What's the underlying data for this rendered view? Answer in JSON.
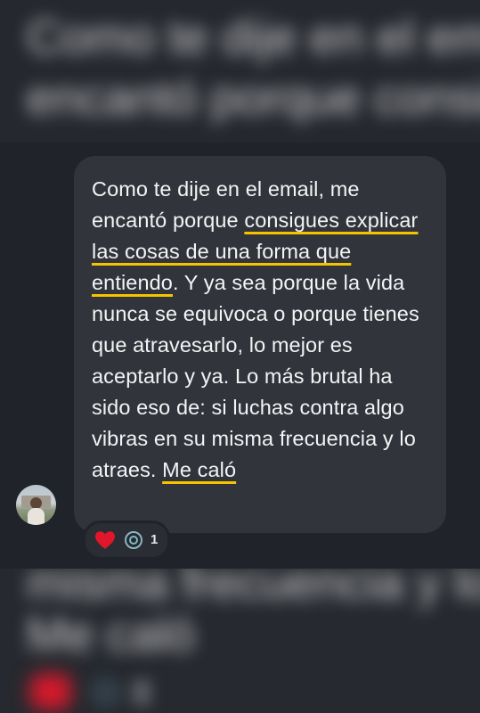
{
  "message": {
    "segments": [
      {
        "text": "Como te dije en el email, me encantó porque ",
        "underline": false
      },
      {
        "text": "consigues explicar las cosas de una forma que entiendo",
        "underline": true
      },
      {
        "text": ". Y ya sea porque la vida nunca se equivoca o porque tienes que atravesarlo, lo mejor es aceptarlo y ya. Lo más brutal ha sido eso de: si luchas contra algo vibras en su misma frecuencia y lo atraes. ",
        "underline": false
      },
      {
        "text": "Me caló",
        "underline": true
      }
    ]
  },
  "reactions": {
    "heart_icon": "red-heart-icon",
    "ring_icon": "concentric-ring-icon",
    "count": "1"
  },
  "colors": {
    "underline_accent": "#f5c400",
    "bubble_bg": "#31343b",
    "page_bg": "#202329",
    "heart": "#e0162b"
  },
  "background": {
    "top_blurred_lines": [
      "Como te dije en el email",
      "encantó porque consig"
    ],
    "bottom_blurred_lines": [
      "misma frecuencia y lo atr",
      "Me caló"
    ]
  }
}
